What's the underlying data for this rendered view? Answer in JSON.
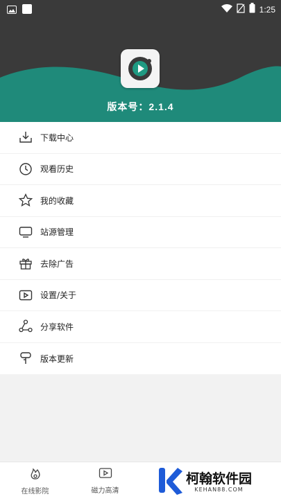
{
  "status_bar": {
    "time": "1:25",
    "icons": [
      "image-icon",
      "app-icon",
      "wifi-icon",
      "no-sim-icon",
      "battery-icon"
    ]
  },
  "header": {
    "version_label": "版本号：2.1.4",
    "logo_icon": "play-icon",
    "colors": {
      "dark": "#3a3a3a",
      "teal": "#1f8a7a"
    }
  },
  "menu": {
    "items": [
      {
        "label": "下载中心",
        "icon": "download-icon"
      },
      {
        "label": "观看历史",
        "icon": "clock-icon"
      },
      {
        "label": "我的收藏",
        "icon": "star-icon"
      },
      {
        "label": "站源管理",
        "icon": "monitor-icon"
      },
      {
        "label": "去除广告",
        "icon": "gift-icon"
      },
      {
        "label": "设置/关于",
        "icon": "play-box-icon"
      },
      {
        "label": "分享软件",
        "icon": "share-icon"
      },
      {
        "label": "版本更新",
        "icon": "update-icon"
      }
    ]
  },
  "bottom_nav": {
    "items": [
      {
        "label": "在线影院",
        "icon": "fire-icon"
      },
      {
        "label": "磁力高清",
        "icon": "play-box-icon"
      }
    ]
  },
  "watermark": {
    "title": "柯翰软件园",
    "subtitle": "KEHAN88.COM"
  }
}
